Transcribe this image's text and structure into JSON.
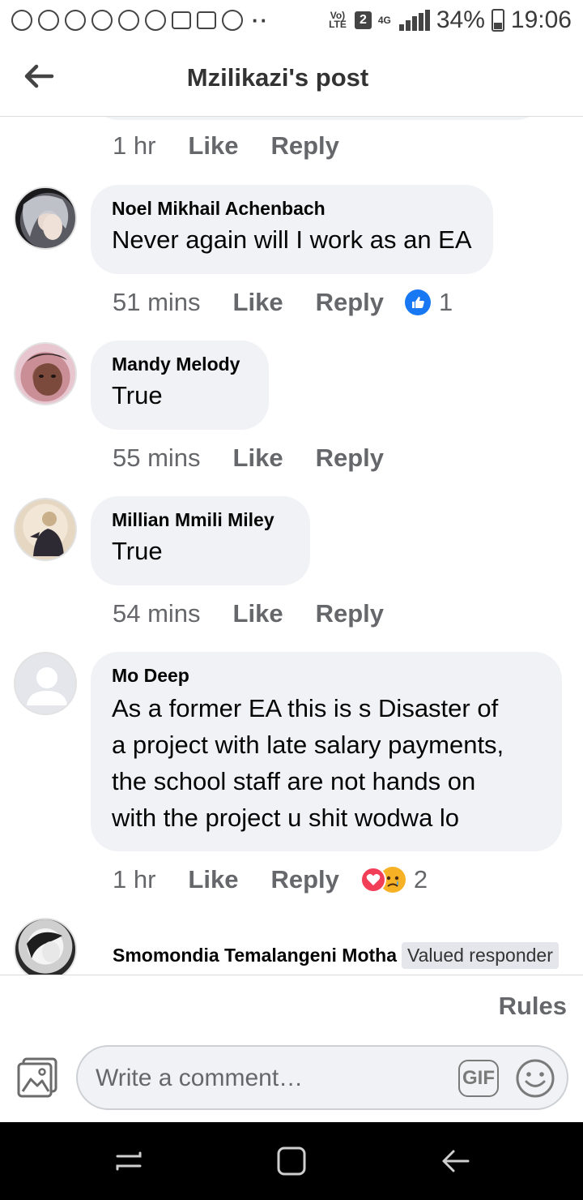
{
  "status_bar": {
    "lte_label": "Vo) LTE",
    "sim_label": "2",
    "network_label": "4G",
    "battery": "34%",
    "time": "19:06"
  },
  "header": {
    "title": "Mzilikazi's post"
  },
  "top_meta": {
    "time": "1 hr",
    "like": "Like",
    "reply": "Reply"
  },
  "comments": [
    {
      "author": "Noel Mikhail Achenbach",
      "text": "Never again will I work as an EA",
      "time": "51 mins",
      "like": "Like",
      "reply": "Reply",
      "reaction_icons": [
        "like-reaction-icon"
      ],
      "reaction_count": "1"
    },
    {
      "author": "Mandy Melody",
      "text": "True",
      "time": "55 mins",
      "like": "Like",
      "reply": "Reply"
    },
    {
      "author": "Millian Mmili Miley",
      "text": "True",
      "time": "54 mins",
      "like": "Like",
      "reply": "Reply"
    },
    {
      "author": "Mo Deep",
      "text_lines": [
        "As a former EA this is s Disaster of",
        "a project with late salary payments,",
        "the school staff are not hands on",
        "with the project u shit wodwa lo"
      ],
      "time": "1 hr",
      "like": "Like",
      "reply": "Reply",
      "reaction_icons": [
        "love-reaction-icon",
        "sad-reaction-icon"
      ],
      "reaction_count": "2"
    },
    {
      "author": "Smomondia Temalangeni Motha",
      "badge": "Valued responder"
    }
  ],
  "footer": {
    "rules": "Rules",
    "input_placeholder": "Write a comment…",
    "gif_label": "GIF"
  },
  "colors": {
    "bubble": "#f0f2f5",
    "meta_text": "#65676b",
    "like_blue": "#1877f2",
    "love_red": "#f33e58",
    "sad_yellow": "#f7b125"
  }
}
